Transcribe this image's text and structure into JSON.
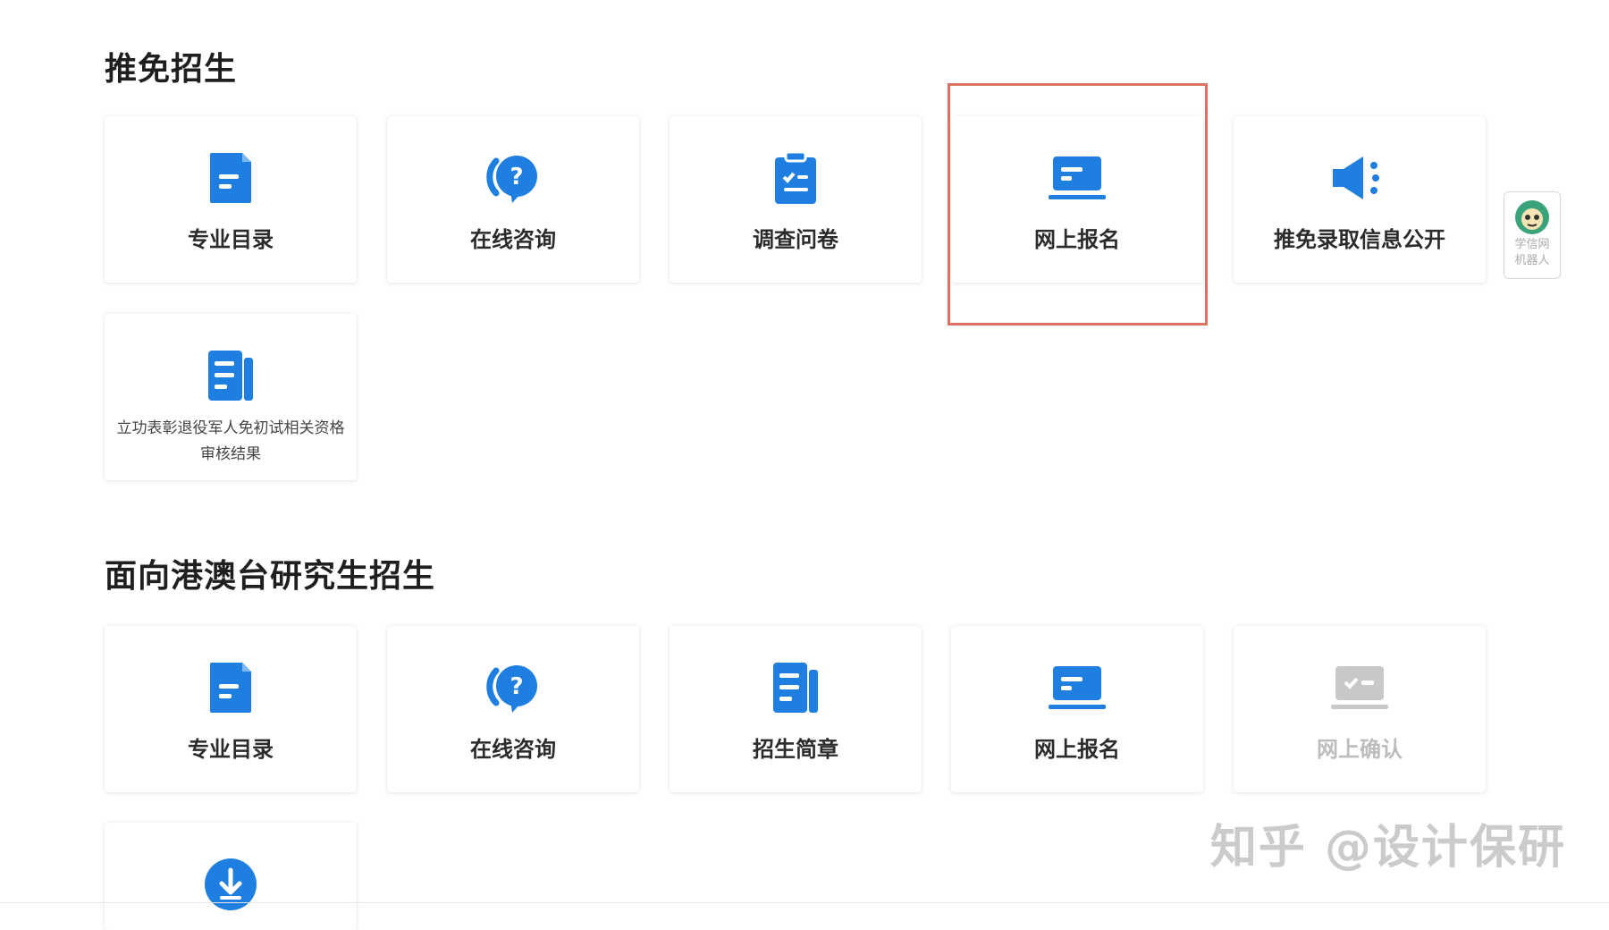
{
  "sections": [
    {
      "title": "推免招生",
      "cards": [
        {
          "label": "专业目录",
          "icon": "catalog-icon"
        },
        {
          "label": "在线咨询",
          "icon": "consult-icon"
        },
        {
          "label": "调查问卷",
          "icon": "questionnaire-icon"
        },
        {
          "label": "网上报名",
          "icon": "online-register-icon"
        },
        {
          "label": "推免录取信息公开",
          "icon": "announce-icon"
        },
        {
          "label": "立功表彰退役军人免初试相关资格审核结果",
          "icon": "document-icon"
        }
      ]
    },
    {
      "title": "面向港澳台研究生招生",
      "cards": [
        {
          "label": "专业目录",
          "icon": "catalog-icon"
        },
        {
          "label": "在线咨询",
          "icon": "consult-icon"
        },
        {
          "label": "招生简章",
          "icon": "document-icon"
        },
        {
          "label": "网上报名",
          "icon": "online-register-icon"
        },
        {
          "label": "网上确认",
          "icon": "online-confirm-icon",
          "disabled": true
        },
        {
          "label": "",
          "icon": "download-icon"
        }
      ]
    }
  ],
  "robot": {
    "line1": "学信网",
    "line2": "机器人"
  },
  "watermark": "知乎 @设计保研",
  "colors": {
    "accent": "#1e7fe0",
    "highlight": "#d9735f",
    "disabled": "#c8c8c8"
  }
}
